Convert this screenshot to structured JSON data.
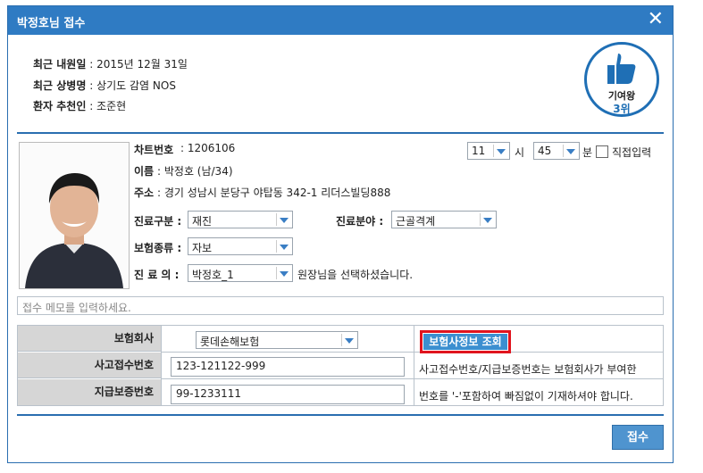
{
  "dialog": {
    "title": "박정호님 접수",
    "close": "✕"
  },
  "summary": {
    "recent_visit_label": "최근 내원일",
    "recent_visit_value": " : 2015년 12월 31일",
    "recent_disease_label": "최근 상병명",
    "recent_disease_value": " : 상기도 감염 NOS",
    "referrer_label": "환자 추천인",
    "referrer_value": " : 조준현"
  },
  "badge": {
    "line1": "기여왕",
    "line2": "3위",
    "icon": "thumbs-up-icon"
  },
  "patient": {
    "chart_label": "차트번호",
    "chart_value": " : 1206106",
    "name_label": "이름",
    "name_value": " : 박정호 (남/34)",
    "addr_label": "주소",
    "addr_value": " : 경기 성남시 분당구 야탑동 342-1 리더스빌딩888"
  },
  "time": {
    "hour": "11",
    "hour_unit": "시",
    "minute": "45",
    "minute_unit": "분",
    "manual_label": "직접입력"
  },
  "form": {
    "visit_type_label": "진료구분 :",
    "visit_type_value": "재진",
    "field_label": "진료분야 :",
    "field_value": "근골격계",
    "insurance_type_label": "보험종류 :",
    "insurance_type_value": "자보",
    "doctor_label": "진 료 의  :",
    "doctor_value": "박정호_1",
    "doctor_note": "원장님을 선택하셨습니다."
  },
  "memo": {
    "placeholder": "접수 메모를 입력하세요."
  },
  "insurance": {
    "company_label": "보험회사",
    "company_value": "롯데손해보험",
    "lookup_button": "보험사정보 조회",
    "accident_label": "사고접수번호",
    "accident_value": "123-121122-999",
    "payment_label": "지급보증번호",
    "payment_value": "99-1233111",
    "note1": "사고접수번호/지급보증번호는 보험회사가 부여한",
    "note2": "번호를 '-'포함하여 빠짐없이 기재하셔야 합니다."
  },
  "submit": {
    "label": "접수"
  },
  "colors": {
    "accent": "#2f7bc3",
    "highlight": "#e0141e"
  }
}
